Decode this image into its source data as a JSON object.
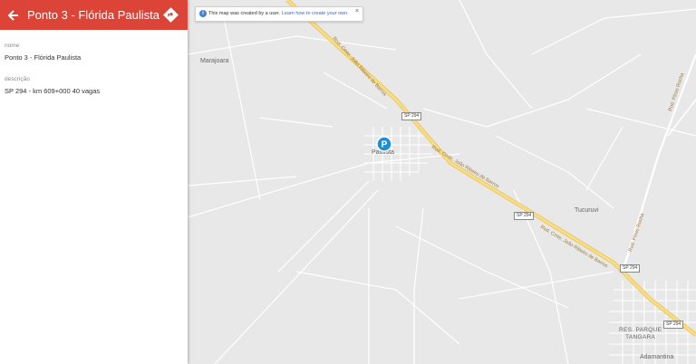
{
  "panel": {
    "title": "Ponto 3 - Flórida Paulista",
    "back_icon": "back-arrow-icon",
    "directions_icon": "directions-icon",
    "accent": "#db4437",
    "fields": [
      {
        "label": "nome",
        "value": "Ponto 3 - Flórida Paulista"
      },
      {
        "label": "descrição",
        "value": "SP 294 - km 609+000 40 vagas"
      }
    ]
  },
  "notice": {
    "text": "This map was created by a user.",
    "link": "Learn how to create your own.",
    "close": "×"
  },
  "map": {
    "places": {
      "marajoara": "Marajoara",
      "paulista": "Paulista",
      "tucuruvi": "Tucuruvi",
      "res_line1": "RES. PARQUE",
      "res_line2": "TANGARA",
      "adamantina": "Adamantina"
    },
    "shields": {
      "s1": "SP 294",
      "s2": "SP 294",
      "s3": "SP 294",
      "s4": "SP 294"
    },
    "road_labels": {
      "r1": "Rod. Cmte. João Ribeiro de Barros",
      "r2": "Rod. Cmte. João Ribeiro de Barros",
      "r3": "Rod. Cmte. João Ribeiro de Barros",
      "r4": "Rod. Plinio Rocha",
      "r5": "Rod. Plinio Rocha"
    },
    "marker": {
      "icon": "parking-icon",
      "letter": "P",
      "color": "#1e8fd5"
    },
    "highway_color": "#f5d97a"
  }
}
